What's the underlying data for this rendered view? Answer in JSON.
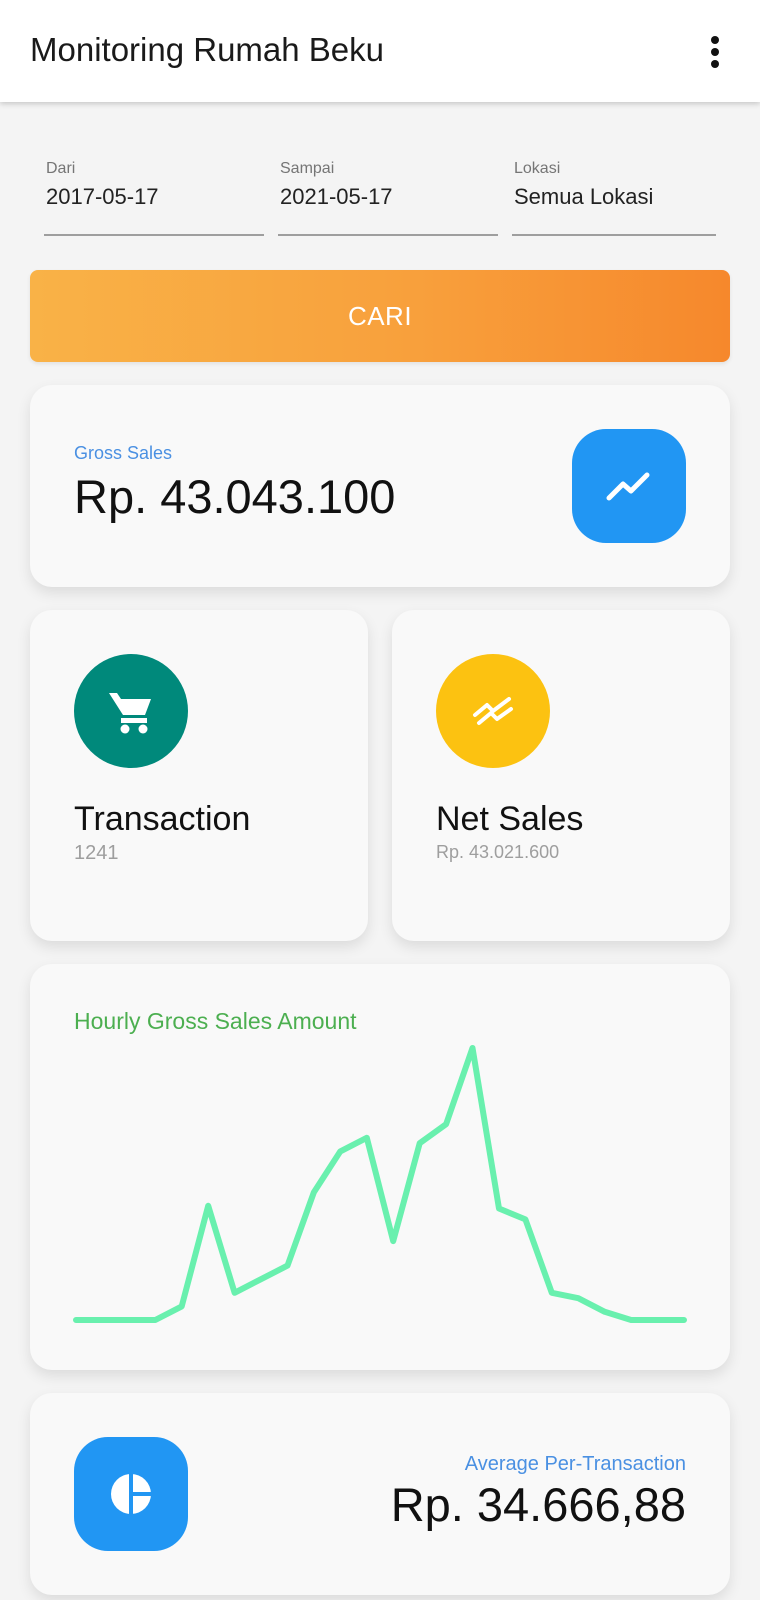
{
  "appbar": {
    "title": "Monitoring Rumah Beku",
    "menu_icon": "more-vert-icon"
  },
  "filters": {
    "from": {
      "label": "Dari",
      "value": "2017-05-17"
    },
    "to": {
      "label": "Sampai",
      "value": "2021-05-17"
    },
    "location": {
      "label": "Lokasi",
      "value": "Semua Lokasi"
    }
  },
  "search_button": {
    "label": "CARI"
  },
  "gross_sales": {
    "label": "Gross Sales",
    "value": "Rp. 43.043.100",
    "icon": "trending-up-icon",
    "icon_color": "#2196f3"
  },
  "transaction": {
    "title": "Transaction",
    "value": "1241",
    "icon": "shopping-cart-icon",
    "icon_color": "#00897b"
  },
  "net_sales": {
    "title": "Net Sales",
    "value": "Rp. 43.021.600",
    "icon": "trending-arrows-icon",
    "icon_color": "#fcc211"
  },
  "hourly_chart": {
    "title": "Hourly Gross Sales Amount"
  },
  "chart_data": {
    "type": "line",
    "title": "Hourly Gross Sales Amount",
    "xlabel": "",
    "ylabel": "",
    "grid": false,
    "color": "#69f0ae",
    "x": [
      0,
      1,
      2,
      3,
      4,
      5,
      6,
      7,
      8,
      9,
      10,
      11,
      12,
      13,
      14,
      15,
      16,
      17,
      18,
      19,
      20,
      21,
      22,
      23
    ],
    "values": [
      0,
      0,
      0,
      0,
      0.05,
      0.42,
      0.1,
      0.15,
      0.2,
      0.47,
      0.62,
      0.67,
      0.29,
      0.65,
      0.72,
      1.0,
      0.41,
      0.37,
      0.1,
      0.08,
      0.03,
      0,
      0,
      0
    ],
    "ylim": [
      0,
      1
    ]
  },
  "average": {
    "label": "Average Per-Transaction",
    "value": "Rp. 34.666,88",
    "icon": "pie-chart-icon",
    "icon_color": "#2196f3"
  }
}
